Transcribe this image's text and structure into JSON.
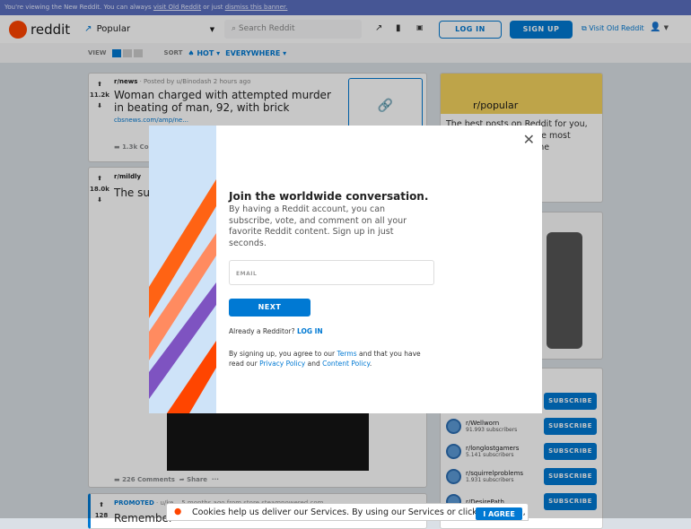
{
  "banner": {
    "text": "You're viewing the New Reddit. You can always ",
    "old_link": "visit Old Reddit",
    "mid": " or just ",
    "dismiss_link": "dismiss this banner."
  },
  "header": {
    "logo": "reddit",
    "feed": "Popular",
    "search_placeholder": "Search Reddit",
    "login": "LOG IN",
    "signup": "SIGN UP",
    "visit_old": "Visit Old Reddit"
  },
  "subbar": {
    "view_label": "VIEW",
    "sort_label": "SORT",
    "sort": "HOT",
    "location": "EVERYWHERE"
  },
  "posts": [
    {
      "votes": "11.2k",
      "subreddit": "r/news",
      "meta": "· Posted by u/Binodash 2 hours ago",
      "title": "Woman charged with attempted murder in beating of man, 92, with brick",
      "link": "cbsnews.com/amp/ne...",
      "comments": "1.3k Comments"
    },
    {
      "votes": "18.0k",
      "subreddit": "r/mildly",
      "title": "The sun",
      "comments": "226 Comments",
      "share": "Share"
    },
    {
      "votes": "128",
      "promoted": "PROMOTED",
      "meta": "· u/ke... 5 months ago from store.steampowered.com",
      "title": "Remember"
    }
  ],
  "sidebar": {
    "popular_title": "r/popular",
    "popular_desc": "The best posts on Reddit for you, pulled ... unities on ... e most shared, ... ontent on the",
    "subscribe": "SUBSCRIBE",
    "communities": [
      {
        "name": "r/Wellworn",
        "subs": "91.993 subscribers"
      },
      {
        "name": "r/longlostgamers",
        "subs": "5.141 subscribers"
      },
      {
        "name": "r/squirrelproblems",
        "subs": "1.931 subscribers"
      },
      {
        "name": "r/DesirePath",
        "subs": ""
      }
    ]
  },
  "modal": {
    "heading": "Join the worldwide conversation.",
    "desc": "By having a Reddit account, you can subscribe, vote, and comment on all your favorite Reddit content. Sign up in just seconds.",
    "email_placeholder": "EMAIL",
    "next": "NEXT",
    "already": "Already a Redditor? ",
    "login": "LOG IN",
    "terms_pre": "By signing up, you agree to our ",
    "terms": "Terms",
    "terms_mid": " and that you have read our ",
    "privacy": "Privacy Policy",
    "and": " and ",
    "content": "Content Policy",
    "end": "."
  },
  "cookie": {
    "text": "Cookies help us deliver our Services. By using our Services or clicking I agree,",
    "agree": "I AGREE"
  }
}
